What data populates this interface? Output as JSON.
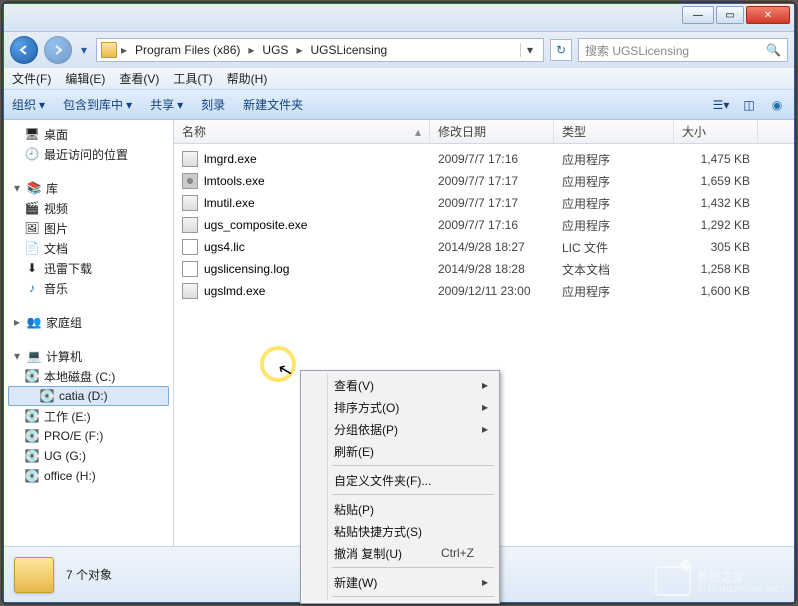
{
  "window": {
    "min": "—",
    "max": "▭",
    "close": "✕"
  },
  "nav": {
    "crumbs": [
      "Program Files (x86)",
      "UGS",
      "UGSLicensing"
    ],
    "search_placeholder": "搜索 UGSLicensing"
  },
  "menubar": [
    "文件(F)",
    "编辑(E)",
    "查看(V)",
    "工具(T)",
    "帮助(H)"
  ],
  "toolbar": {
    "organize": "组织",
    "include": "包含到库中",
    "share": "共享",
    "burn": "刻录",
    "newfolder": "新建文件夹"
  },
  "sidebar": {
    "desktop": "桌面",
    "recent": "最近访问的位置",
    "library": "库",
    "video": "视频",
    "pictures": "图片",
    "docs": "文档",
    "xunlei": "迅雷下载",
    "music": "音乐",
    "homegroup": "家庭组",
    "computer": "计算机",
    "drives": [
      "本地磁盘 (C:)",
      "catia (D:)",
      "工作 (E:)",
      "PRO/E (F:)",
      "UG (G:)",
      "office (H:)"
    ]
  },
  "columns": {
    "name": "名称",
    "date": "修改日期",
    "type": "类型",
    "size": "大小"
  },
  "files": [
    {
      "icon": "exe",
      "name": "lmgrd.exe",
      "date": "2009/7/7 17:16",
      "type": "应用程序",
      "size": "1,475 KB"
    },
    {
      "icon": "gear",
      "name": "lmtools.exe",
      "date": "2009/7/7 17:17",
      "type": "应用程序",
      "size": "1,659 KB"
    },
    {
      "icon": "exe",
      "name": "lmutil.exe",
      "date": "2009/7/7 17:17",
      "type": "应用程序",
      "size": "1,432 KB"
    },
    {
      "icon": "exe",
      "name": "ugs_composite.exe",
      "date": "2009/7/7 17:16",
      "type": "应用程序",
      "size": "1,292 KB"
    },
    {
      "icon": "txt",
      "name": "ugs4.lic",
      "date": "2014/9/28 18:27",
      "type": "LIC 文件",
      "size": "305 KB"
    },
    {
      "icon": "log",
      "name": "ugslicensing.log",
      "date": "2014/9/28 18:28",
      "type": "文本文档",
      "size": "1,258 KB"
    },
    {
      "icon": "exe",
      "name": "ugslmd.exe",
      "date": "2009/12/11 23:00",
      "type": "应用程序",
      "size": "1,600 KB"
    }
  ],
  "status": {
    "count": "7 个对象"
  },
  "context_menu": [
    {
      "label": "查看(V)",
      "sub": true
    },
    {
      "label": "排序方式(O)",
      "sub": true
    },
    {
      "label": "分组依据(P)",
      "sub": true
    },
    {
      "label": "刷新(E)"
    },
    {
      "sep": true
    },
    {
      "label": "自定义文件夹(F)..."
    },
    {
      "sep": true
    },
    {
      "label": "粘贴(P)"
    },
    {
      "label": "粘贴快捷方式(S)"
    },
    {
      "label": "撤消 复制(U)",
      "shortcut": "Ctrl+Z"
    },
    {
      "sep": true
    },
    {
      "label": "新建(W)",
      "sub": true
    },
    {
      "sep": true
    }
  ],
  "watermark": {
    "main": "系统之家",
    "sub": "XITONGZHIJIA.NET"
  }
}
